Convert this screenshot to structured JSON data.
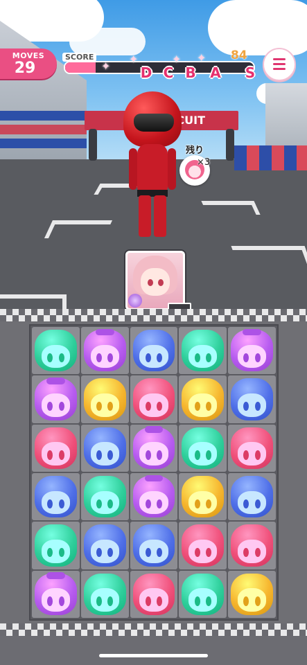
{
  "hud": {
    "moves_label": "MOVES",
    "moves_value": "29",
    "score_label": "SCORE",
    "score_value": "84",
    "score_progress": 0.16,
    "ranks": [
      "D",
      "C",
      "B",
      "A",
      "S"
    ],
    "menu_icon": "hamburger-menu-icon"
  },
  "scene": {
    "gate_text": "CUIT",
    "remaining_label": "残り",
    "remaining_count": "×3",
    "target_piece_color": "pink"
  },
  "board": {
    "cols": 5,
    "rows": 6,
    "palette": {
      "green": "#2fcf9b",
      "purple": "#b75cf0",
      "blue": "#4f6fe8",
      "pink": "#f0507a",
      "yellow": "#f6b52e"
    },
    "pieces": [
      [
        "green",
        "purple",
        "blue",
        "green",
        "purple"
      ],
      [
        "purple",
        "yellow",
        "pink",
        "yellow",
        "blue"
      ],
      [
        "pink",
        "blue",
        "purple",
        "green",
        "pink"
      ],
      [
        "blue",
        "green",
        "purple",
        "yellow",
        "blue"
      ],
      [
        "green",
        "blue",
        "blue",
        "pink",
        "pink"
      ],
      [
        "purple",
        "green",
        "pink",
        "green",
        "yellow"
      ]
    ]
  }
}
